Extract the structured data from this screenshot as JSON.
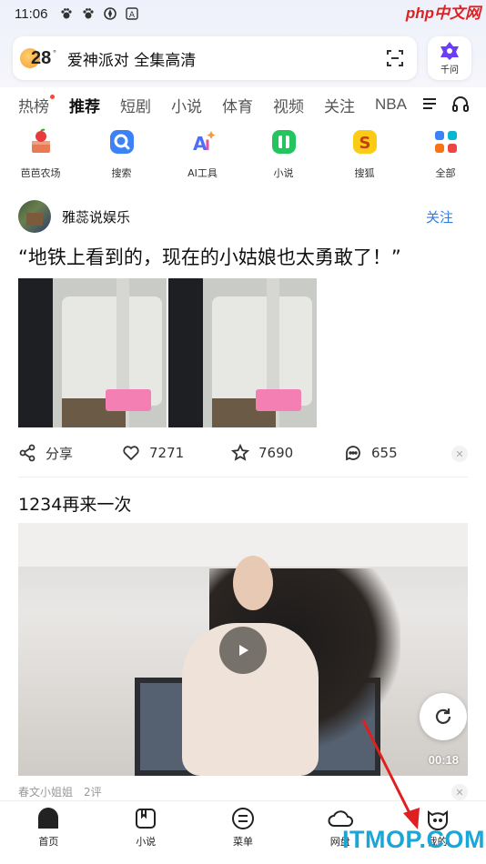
{
  "status_bar": {
    "time": "11:06",
    "watermark": "php中文网"
  },
  "search": {
    "temperature": "28",
    "degree": "°",
    "query": "爱神派对 全集高清"
  },
  "qianwen": {
    "label": "千问"
  },
  "tabs": [
    "热榜",
    "推荐",
    "短剧",
    "小说",
    "体育",
    "视频",
    "关注",
    "NBA"
  ],
  "active_tab": "推荐",
  "shortcuts": [
    {
      "label": "芭芭农场",
      "icon": "farm-icon"
    },
    {
      "label": "搜索",
      "icon": "search-app-icon"
    },
    {
      "label": "AI工具",
      "icon": "ai-tools-icon"
    },
    {
      "label": "小说",
      "icon": "novel-app-icon"
    },
    {
      "label": "搜狐",
      "icon": "sohu-icon"
    },
    {
      "label": "全部",
      "icon": "all-apps-icon"
    }
  ],
  "post1": {
    "author": "雅蕊说娱乐",
    "follow": "关注",
    "title": "“地铁上看到的，现在的小姑娘也太勇敢了！”",
    "share_label": "分享",
    "likes": "7271",
    "favorites": "7690",
    "comments": "655"
  },
  "post2": {
    "title": "1234再来一次",
    "duration": "00:18",
    "source": "春文小姐姐",
    "comments": "2评"
  },
  "bottom_nav": [
    {
      "label": "首页",
      "icon": "home-icon"
    },
    {
      "label": "小说",
      "icon": "book-icon"
    },
    {
      "label": "菜单",
      "icon": "menu-icon"
    },
    {
      "label": "网盘",
      "icon": "cloud-icon"
    },
    {
      "label": "我的",
      "icon": "profile-icon"
    }
  ],
  "overlay": {
    "watermark": "ITMOP.COM",
    "arrow_color": "#e02020"
  },
  "colors": {
    "accent": "#2e7be6",
    "text": "#111111"
  }
}
